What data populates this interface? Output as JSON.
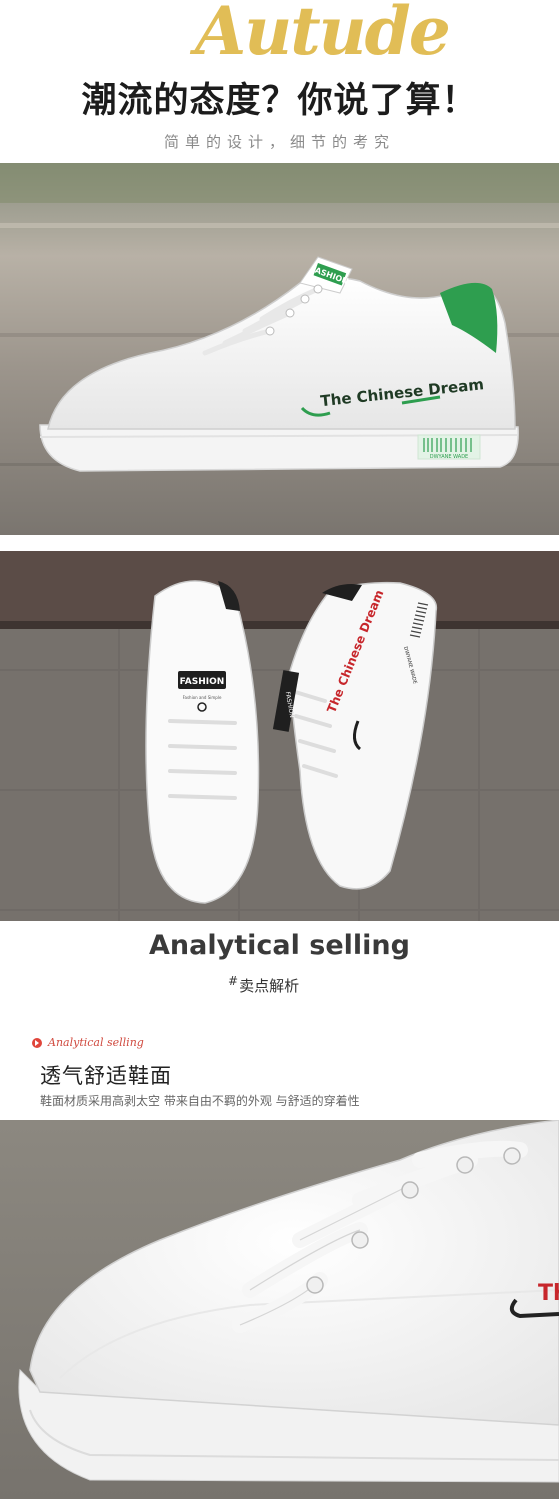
{
  "header": {
    "script_word": "Autude",
    "headline": "潮流的态度？你说了算！",
    "subheadline": "简单的设计，细节的考究"
  },
  "photo1": {
    "tongue_label": "FASHION",
    "side_text": "The Chinese Dream",
    "heel_tag": "DWYANE WADE"
  },
  "photo2": {
    "tongue_label": "FASHION",
    "tongue_sub": "Fashion and Simple",
    "side_text": "The Chinese Dream",
    "heel_tag": "DWYANE WADE"
  },
  "selling": {
    "title": "Analytical selling",
    "subtitle_hash": "#",
    "subtitle": "卖点解析"
  },
  "feature": {
    "tag": "Analytical selling",
    "title": "透气舒适鞋面",
    "description": "鞋面材质采用高剥太空 带来自由不羁的外观 与舒适的穿着性"
  },
  "photo3": {
    "side_text_fragment": "Th"
  },
  "colors": {
    "accent_green": "#2e9e4f",
    "accent_red": "#c7262b",
    "script_gold": "#e0ba4e"
  }
}
